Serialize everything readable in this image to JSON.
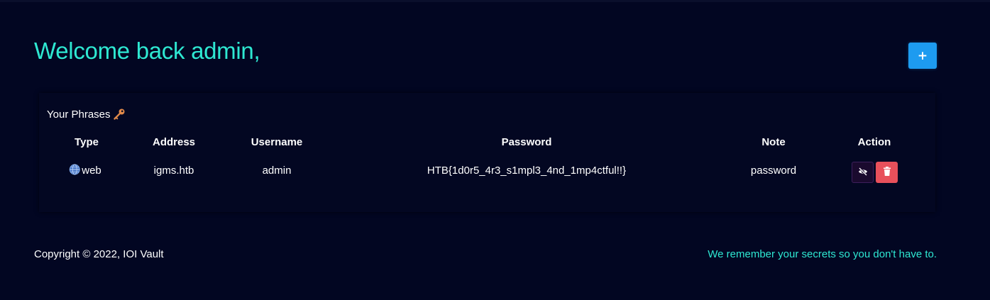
{
  "header": {
    "welcome": "Welcome back admin,",
    "add_button_label": "+"
  },
  "phrases": {
    "title": "Your Phrases",
    "title_icon": "key-icon",
    "columns": [
      "Type",
      "Address",
      "Username",
      "Password",
      "Note",
      "Action"
    ],
    "rows": [
      {
        "type_icon": "globe-icon",
        "type": "web",
        "address": "igms.htb",
        "username": "admin",
        "password": "HTB{1d0r5_4r3_s1mpl3_4nd_1mp4ctful!!}",
        "note": "password",
        "actions": [
          "eye-slash-icon",
          "trash-icon"
        ]
      }
    ]
  },
  "footer": {
    "copyright": "Copyright © 2022, IOI Vault",
    "tagline": "We remember your secrets so you don't have to."
  },
  "colors": {
    "background": "#020622",
    "accent": "#2ee8d2",
    "add_button": "#1d9bf0",
    "delete_button": "#e8505b",
    "view_button": "#1a0a2e"
  }
}
